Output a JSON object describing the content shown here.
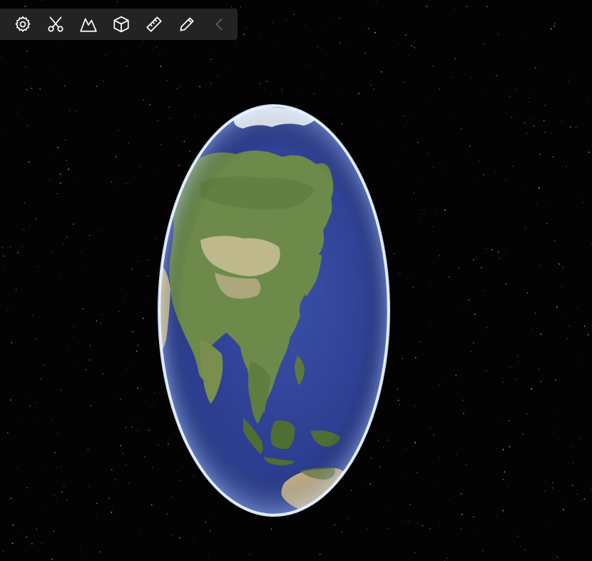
{
  "toolbar": {
    "tools": [
      {
        "name": "settings",
        "icon": "gear-icon"
      },
      {
        "name": "clip",
        "icon": "scissors-icon"
      },
      {
        "name": "terrain",
        "icon": "mountain-icon"
      },
      {
        "name": "model",
        "icon": "cube-icon"
      },
      {
        "name": "measure",
        "icon": "ruler-icon"
      },
      {
        "name": "draw",
        "icon": "pencil-icon"
      },
      {
        "name": "collapse",
        "icon": "chevron-left-icon"
      }
    ]
  },
  "scene": {
    "background": "#030303",
    "ocean_color": "#2d3f94",
    "atmosphere_color": "#cfe3ff",
    "land_color": "#6e8a48",
    "desert_color": "#cbbf98",
    "ice_color": "#f3f6fa"
  }
}
